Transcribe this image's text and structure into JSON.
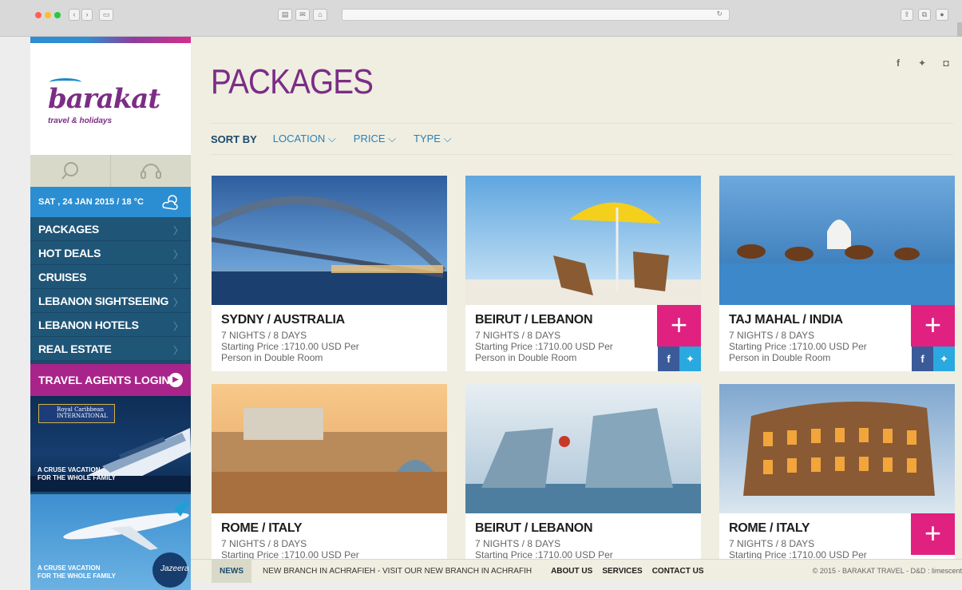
{
  "browser": {
    "traffic_lights": [
      "#fe5f57",
      "#febc2e",
      "#28c840"
    ]
  },
  "brand": {
    "name": "barakat",
    "tagline": "travel & holidays"
  },
  "sidebar": {
    "date_weather": "SAT , 24 JAN 2015 / 18 °C",
    "items": [
      {
        "label": "PACKAGES"
      },
      {
        "label": "HOT DEALS"
      },
      {
        "label": "CRUISES"
      },
      {
        "label": "LEBANON SIGHTSEEING"
      },
      {
        "label": "LEBANON HOTELS"
      },
      {
        "label": "REAL ESTATE"
      }
    ],
    "agents_login": "TRAVEL AGENTS LOGIN",
    "ads": [
      {
        "brand": "Royal Caribbean INTERNATIONAL",
        "text_line1": "A CRUSE VACATION",
        "text_line2": "FOR THE WHOLE FAMILY"
      },
      {
        "brand": "Jazeera",
        "text_line1": "A CRUSE VACATION",
        "text_line2": "FOR THE WHOLE FAMILY"
      }
    ]
  },
  "main": {
    "title": "PACKAGES",
    "sort": {
      "label": "SORT BY",
      "options": [
        "LOCATION",
        "PRICE",
        "TYPE"
      ]
    },
    "cards": [
      {
        "title": "SYDNY / AUSTRALIA",
        "duration": "7 NIGHTS / 8 DAYS",
        "price_line1": "Starting Price :1710.00 USD Per",
        "price_line2": "Person in Double Room",
        "has_plus": false
      },
      {
        "title": "BEIRUT / LEBANON",
        "duration": "7 NIGHTS / 8 DAYS",
        "price_line1": "Starting Price :1710.00 USD Per",
        "price_line2": "Person in Double Room",
        "has_plus": true
      },
      {
        "title": "TAJ MAHAL / INDIA",
        "duration": "7 NIGHTS / 8 DAYS",
        "price_line1": "Starting Price :1710.00 USD Per",
        "price_line2": "Person in Double Room",
        "has_plus": true
      },
      {
        "title": "ROME / ITALY",
        "duration": "7 NIGHTS / 8 DAYS",
        "price_line1": "Starting Price :1710.00 USD Per",
        "price_line2": "",
        "has_plus": false
      },
      {
        "title": "BEIRUT / LEBANON",
        "duration": "7 NIGHTS / 8 DAYS",
        "price_line1": "Starting Price :1710.00 USD Per",
        "price_line2": "",
        "has_plus": false
      },
      {
        "title": "ROME / ITALY",
        "duration": "7 NIGHTS / 8 DAYS",
        "price_line1": "Starting Price :1710.00 USD Per",
        "price_line2": "",
        "has_plus": true
      }
    ],
    "plus_symbol": "+",
    "fb": "f",
    "tw": "t"
  },
  "footer": {
    "news_label": "NEWS",
    "news_text": "NEW BRANCH IN ACHRAFIEH - VISIT OUR NEW BRANCH IN ACHRAFIH",
    "links": [
      "ABOUT US",
      "SERVICES",
      "CONTACT US"
    ],
    "copyright": "© 2015 - BARAKAT TRAVEL - D&D : limescent"
  },
  "colors": {
    "brand_purple": "#7b2d85",
    "accent_pink": "#e1217f",
    "nav_blue": "#1f5577",
    "date_blue": "#2b8ed2",
    "agents_magenta": "#a8248a"
  }
}
